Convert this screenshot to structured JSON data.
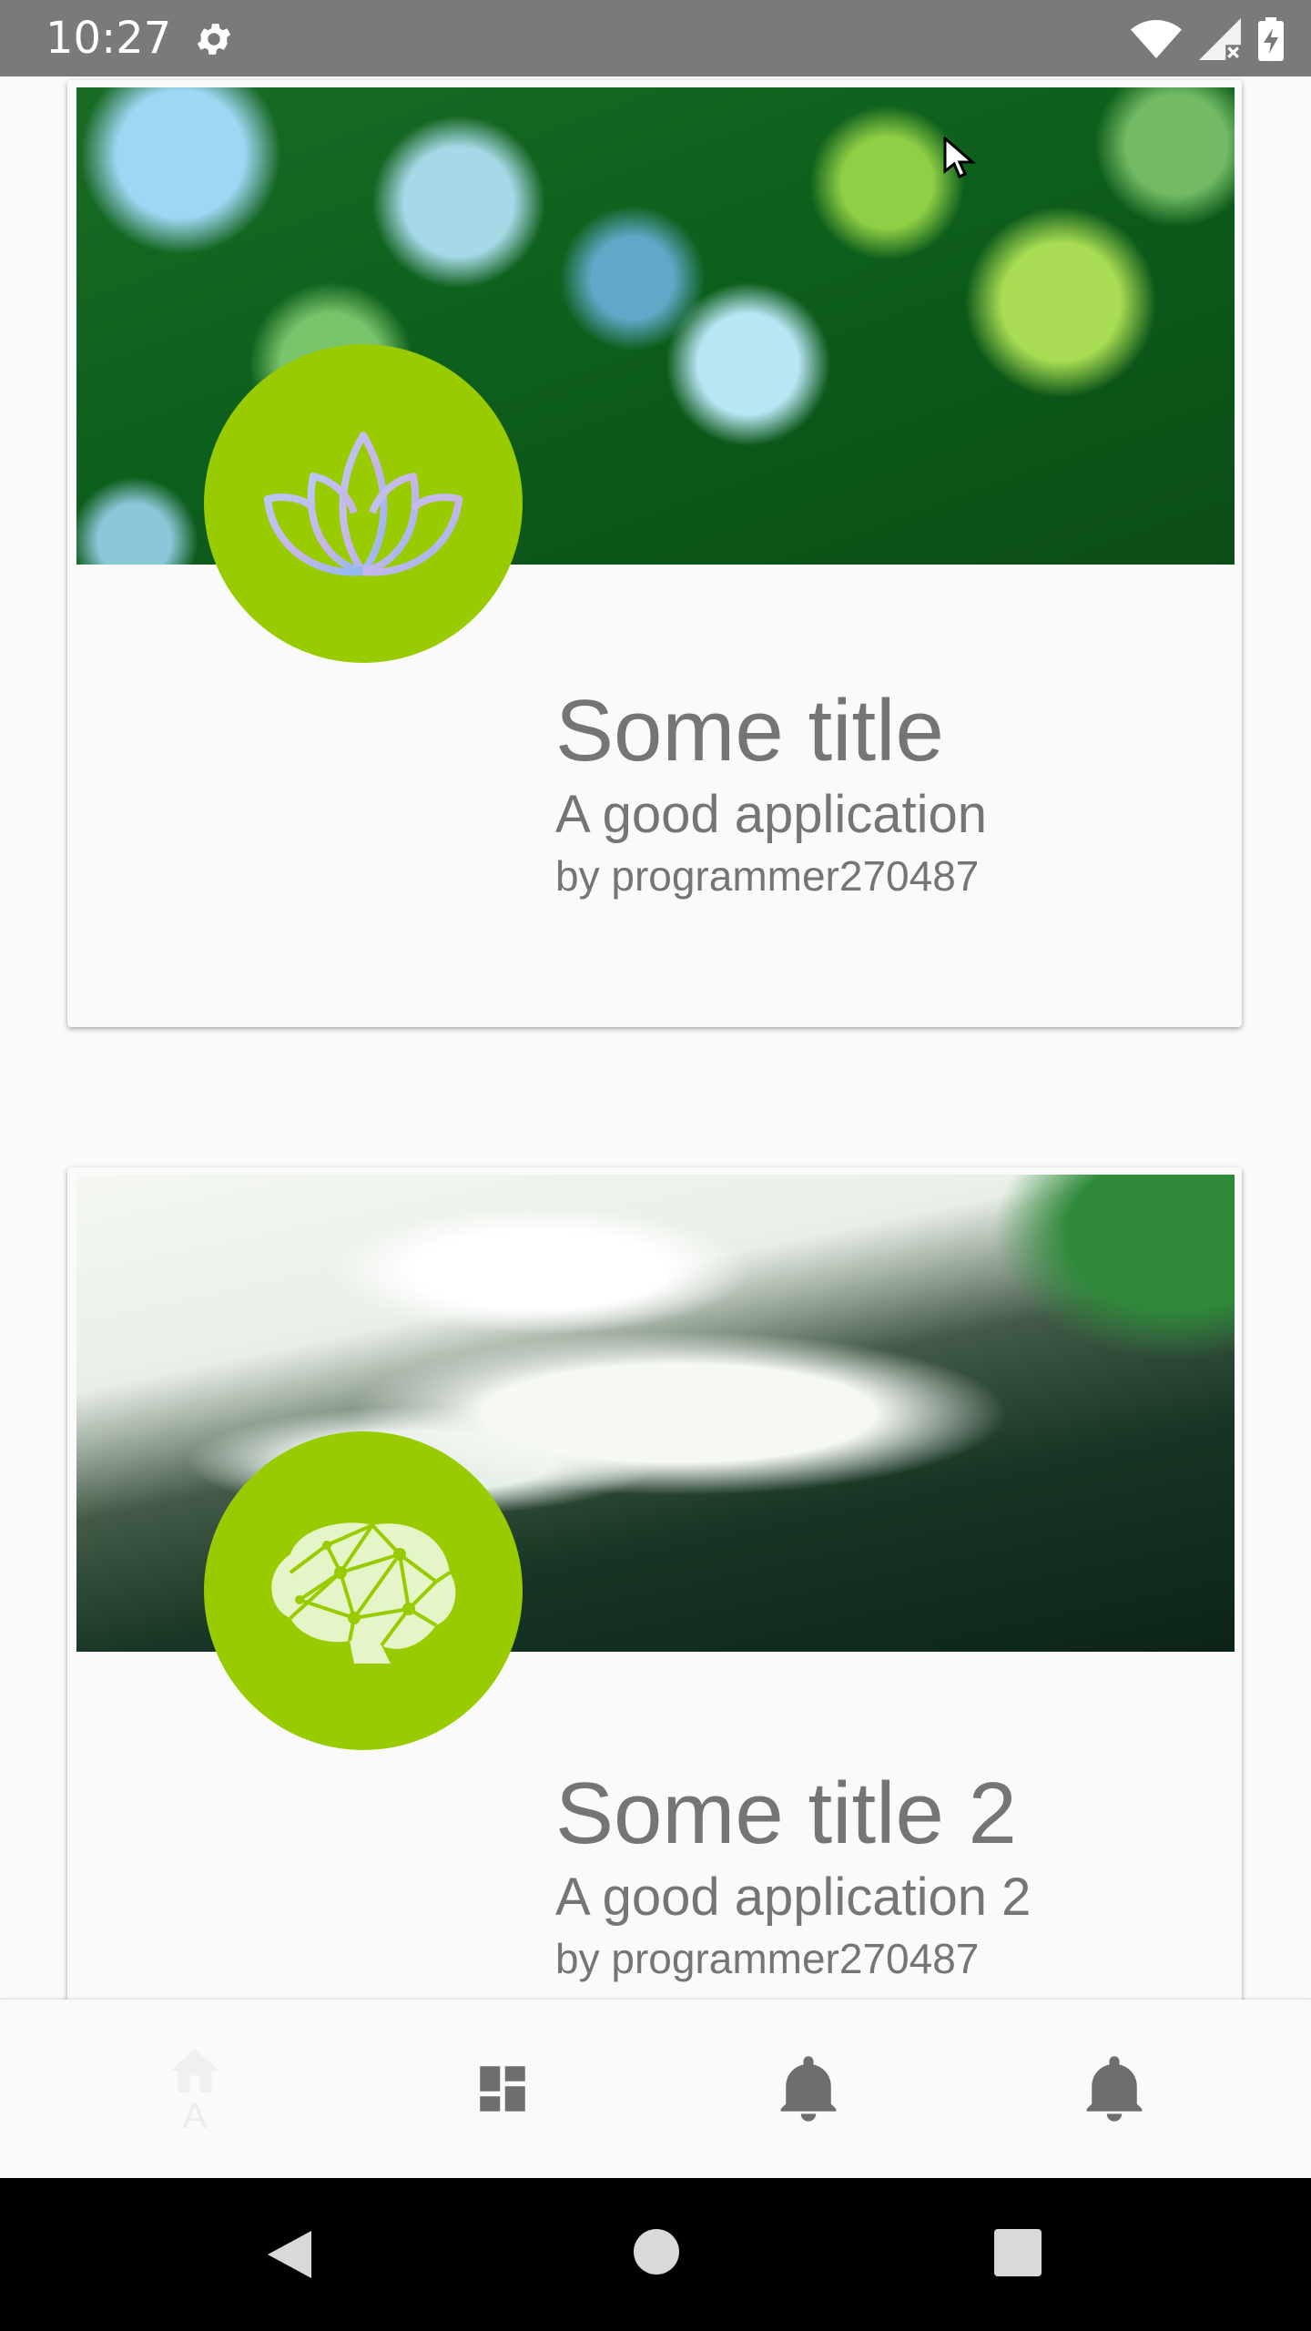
{
  "status_bar": {
    "time": "10:27",
    "icons": [
      "settings-icon",
      "wifi-icon",
      "signal-icon",
      "battery-charging-icon"
    ]
  },
  "cards": [
    {
      "title": "Some title",
      "subtitle": "A good application",
      "author": "by programmer270487",
      "icon": "lotus-icon"
    },
    {
      "title": "Some title 2",
      "subtitle": "A good application 2",
      "author": "by programmer270487",
      "icon": "brain-icon"
    }
  ],
  "bottom_nav": {
    "items": [
      {
        "icon": "home-icon",
        "label": "A"
      },
      {
        "icon": "dashboard-icon",
        "label": ""
      },
      {
        "icon": "bell-icon",
        "label": ""
      },
      {
        "icon": "bell-icon",
        "label": ""
      }
    ]
  },
  "system_nav": [
    "back-icon",
    "home-circle-icon",
    "recents-icon"
  ],
  "colors": {
    "status_bar": "#7A7A7A",
    "accent": "#99CC00",
    "text": "#757575",
    "nav_icon": "#6E6E6E"
  }
}
